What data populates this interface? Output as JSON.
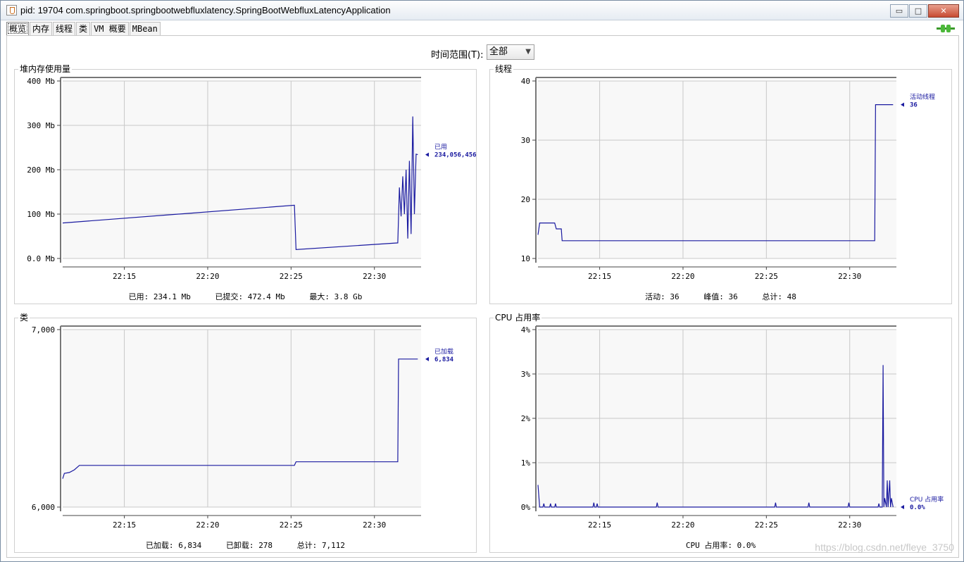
{
  "window": {
    "title": "pid: 19704 com.springboot.springbootwebfluxlatency.SpringBootWebfluxLatencyApplication",
    "buttons": {
      "minimize": "▭",
      "maximize": "□",
      "close": "✕"
    }
  },
  "tabs": [
    {
      "label": "概览",
      "active": true
    },
    {
      "label": "内存"
    },
    {
      "label": "线程"
    },
    {
      "label": "类"
    },
    {
      "label": "VM 概要"
    },
    {
      "label": "MBean"
    }
  ],
  "time_range": {
    "label": "时间范围(T):",
    "value": "全部"
  },
  "icons": {
    "connection": "plug-icon"
  },
  "colors": {
    "series": "#1a1aa0",
    "grid": "#c8c8c8",
    "plot_bg": "#f8f8f8"
  },
  "panels": {
    "heap": {
      "title": "堆内存使用量",
      "stats": [
        {
          "label": "已用:",
          "value": "234.1  Mb"
        },
        {
          "label": "已提交:",
          "value": "472.4  Mb"
        },
        {
          "label": "最大:",
          "value": "3.8  Gb"
        }
      ]
    },
    "threads": {
      "title": "线程",
      "stats": [
        {
          "label": "活动:",
          "value": "36"
        },
        {
          "label": "峰值:",
          "value": "36"
        },
        {
          "label": "总计:",
          "value": "48"
        }
      ]
    },
    "classes": {
      "title": "类",
      "stats": [
        {
          "label": "已加载:",
          "value": "6,834"
        },
        {
          "label": "已卸载:",
          "value": "278"
        },
        {
          "label": "总计:",
          "value": "7,112"
        }
      ]
    },
    "cpu": {
      "title": "CPU 占用率",
      "stats": [
        {
          "label": "CPU 占用率:",
          "value": "0.0%"
        }
      ]
    }
  },
  "watermark": "https://blog.csdn.net/fleye_3750",
  "chart_data": [
    {
      "id": "heap",
      "type": "line",
      "x_ticks": [
        "22:15",
        "22:20",
        "22:25",
        "22:30"
      ],
      "x_tick_minutes": [
        15,
        20,
        25,
        30
      ],
      "xlim": [
        11.3,
        32.8
      ],
      "y_ticks": [
        "0.0 Mb",
        "100 Mb",
        "200 Mb",
        "300 Mb",
        "400 Mb"
      ],
      "y_tick_values": [
        0,
        100,
        200,
        300,
        400
      ],
      "ylim": [
        0,
        400
      ],
      "series": [
        {
          "name": "已用",
          "value_label": "234,056,456",
          "x": [
            11.3,
            25.2,
            25.3,
            31.4,
            31.5,
            31.6,
            31.7,
            31.8,
            31.9,
            32.0,
            32.1,
            32.2,
            32.3,
            32.4,
            32.5,
            32.6
          ],
          "y": [
            80,
            120,
            20,
            35,
            160,
            95,
            185,
            100,
            200,
            45,
            220,
            55,
            320,
            100,
            235,
            234
          ]
        }
      ]
    },
    {
      "id": "threads",
      "type": "line",
      "x_ticks": [
        "22:15",
        "22:20",
        "22:25",
        "22:30"
      ],
      "x_tick_minutes": [
        15,
        20,
        25,
        30
      ],
      "xlim": [
        11.3,
        32.8
      ],
      "y_ticks": [
        "10",
        "20",
        "30",
        "40"
      ],
      "y_tick_values": [
        10,
        20,
        30,
        40
      ],
      "ylim": [
        10,
        40
      ],
      "series": [
        {
          "name": "活动线程",
          "value_label": "36",
          "x": [
            11.3,
            11.4,
            12.3,
            12.4,
            12.7,
            12.75,
            31.5,
            31.55,
            32.6
          ],
          "y": [
            14,
            16,
            16,
            15,
            15,
            13,
            13,
            36,
            36
          ]
        }
      ]
    },
    {
      "id": "classes",
      "type": "line",
      "x_ticks": [
        "22:15",
        "22:20",
        "22:25",
        "22:30"
      ],
      "x_tick_minutes": [
        15,
        20,
        25,
        30
      ],
      "xlim": [
        11.3,
        32.8
      ],
      "y_ticks": [
        "6,000",
        "7,000"
      ],
      "y_tick_values": [
        6000,
        7000
      ],
      "ylim": [
        6000,
        7000
      ],
      "series": [
        {
          "name": "已加载",
          "value_label": "6,834",
          "x": [
            11.3,
            11.4,
            11.7,
            12.0,
            12.3,
            25.2,
            25.3,
            31.4,
            31.45,
            32.6
          ],
          "y": [
            6160,
            6190,
            6195,
            6210,
            6235,
            6235,
            6255,
            6255,
            6834,
            6834
          ]
        }
      ]
    },
    {
      "id": "cpu",
      "type": "line",
      "x_ticks": [
        "22:15",
        "22:20",
        "22:25",
        "22:30"
      ],
      "x_tick_minutes": [
        15,
        20,
        25,
        30
      ],
      "xlim": [
        11.3,
        32.8
      ],
      "y_ticks": [
        "0%",
        "1%",
        "2%",
        "3%",
        "4%"
      ],
      "y_tick_values": [
        0,
        1,
        2,
        3,
        4
      ],
      "ylim": [
        0,
        4
      ],
      "series": [
        {
          "name": "CPU 占用率",
          "value_label": "0.0%",
          "x": [
            11.3,
            11.4,
            11.6,
            11.65,
            11.7,
            12.0,
            12.05,
            12.1,
            12.3,
            12.35,
            12.4,
            14.6,
            14.65,
            14.7,
            14.8,
            14.85,
            14.9,
            18.4,
            18.45,
            18.5,
            25.5,
            25.55,
            25.6,
            27.5,
            27.55,
            27.6,
            29.9,
            29.95,
            30.0,
            31.7,
            31.75,
            31.8,
            31.95,
            32.0,
            32.05,
            32.1,
            32.2,
            32.25,
            32.3,
            32.4,
            32.45,
            32.5,
            32.6
          ],
          "y": [
            0.5,
            0,
            0,
            0.08,
            0,
            0,
            0.08,
            0,
            0,
            0.08,
            0,
            0,
            0.1,
            0,
            0,
            0.08,
            0,
            0,
            0.1,
            0,
            0,
            0.1,
            0,
            0,
            0.1,
            0,
            0,
            0.1,
            0,
            0,
            0.08,
            0,
            0,
            3.2,
            0,
            0.2,
            0,
            0.6,
            0,
            0.6,
            0,
            0.2,
            0
          ]
        }
      ]
    }
  ]
}
